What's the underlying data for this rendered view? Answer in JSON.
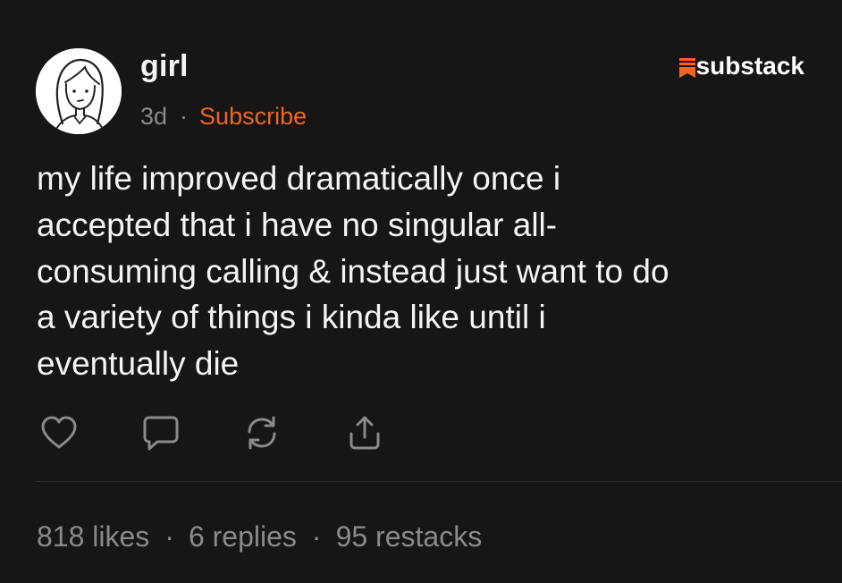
{
  "author": {
    "name": "girl",
    "avatar_icon": "girl-drawing-avatar"
  },
  "meta": {
    "time": "3d",
    "separator": "·",
    "subscribe_label": "Subscribe"
  },
  "brand": {
    "name": "substack",
    "logo_icon": "substack-logo-icon"
  },
  "note": {
    "text": "my life improved dramatically once i\naccepted that i have no singular all-\nconsuming calling & instead just want to do\na variety of things i kinda like until i\neventually die"
  },
  "actions": [
    {
      "icon": "heart-icon"
    },
    {
      "icon": "comment-icon"
    },
    {
      "icon": "restack-icon"
    },
    {
      "icon": "share-icon"
    }
  ],
  "stats": {
    "likes": "818 likes",
    "replies": "6 replies",
    "restacks": "95 restacks",
    "separator": "·"
  },
  "colors": {
    "background": "#161616",
    "accent": "#f0661d",
    "muted": "#8a8a8a",
    "text": "#f4f4f4"
  }
}
